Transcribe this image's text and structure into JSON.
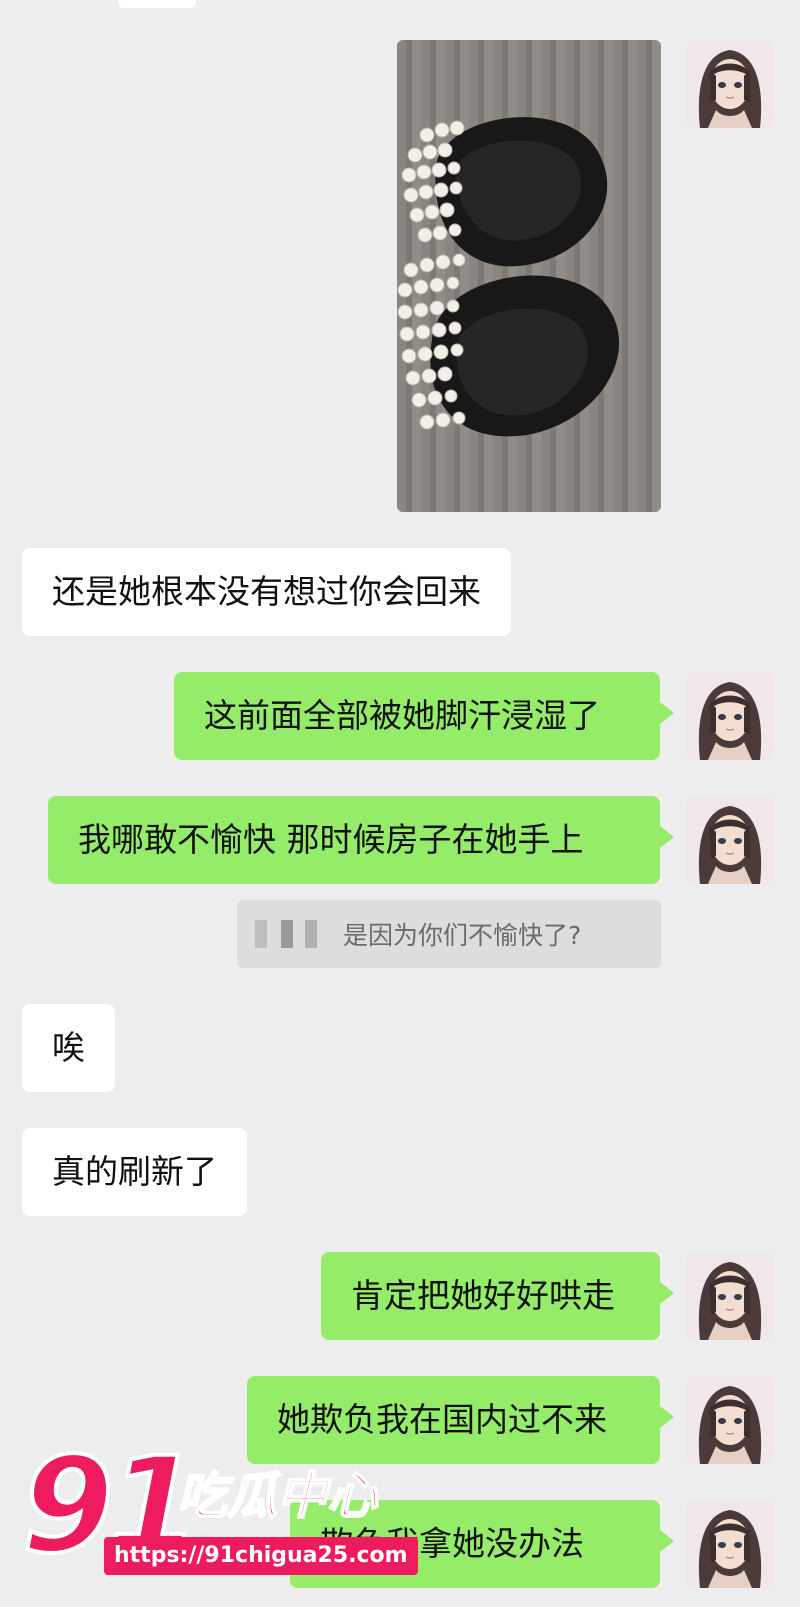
{
  "conversation": {
    "messages": [
      {
        "side": "in",
        "text": "还是她根本没有想过你会回来"
      },
      {
        "side": "out",
        "text": "这前面全部被她脚汗浸湿了"
      },
      {
        "side": "out",
        "text": "我哪敢不愉快 那时候房子在她手上"
      },
      {
        "side": "in",
        "text": "唉"
      },
      {
        "side": "in",
        "text": "真的刷新了"
      },
      {
        "side": "out",
        "text": "肯定把她好好哄走"
      },
      {
        "side": "out",
        "text": "她欺负我在国内过不来"
      },
      {
        "side": "out",
        "text": "欺负我拿她没办法"
      }
    ],
    "quote": {
      "text": "是因为你们不愉快了?"
    },
    "image_message": {
      "subject": "pearl-strand-slippers-photo"
    }
  },
  "watermark": {
    "number": "91",
    "name": "吃瓜中心",
    "url": "https://91chigua25.com"
  },
  "colors": {
    "background": "#ededed",
    "outgoing_bubble": "#95ec69",
    "incoming_bubble": "#ffffff",
    "watermark_accent": "#ee1c5f"
  }
}
